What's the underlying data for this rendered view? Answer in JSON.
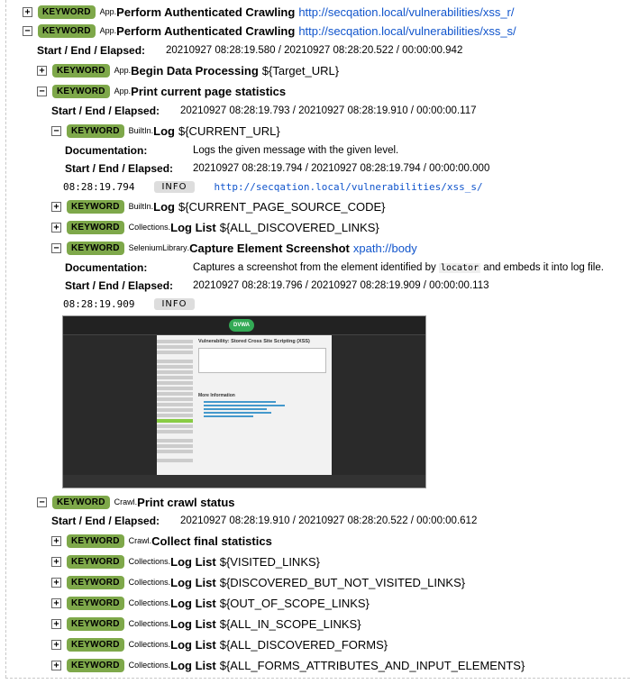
{
  "badge": "KEYWORD",
  "level_info": "INFO",
  "start_end_label": "Start / End / Elapsed:",
  "documentation_label": "Documentation:",
  "kw1": {
    "lib": "App",
    "name": "Perform Authenticated Crawling",
    "arg": "http://secqation.local/vulnerabilities/xss_r/",
    "toggle": "+"
  },
  "kw2": {
    "lib": "App",
    "name": "Perform Authenticated Crawling",
    "arg": "http://secqation.local/vulnerabilities/xss_s/",
    "toggle": "−",
    "times": "20210927 08:28:19.580 / 20210927 08:28:20.522 / 00:00:00.942"
  },
  "kw3": {
    "lib": "App",
    "name": "Begin Data Processing",
    "arg": "${Target_URL}",
    "toggle": "+"
  },
  "kw4": {
    "lib": "App",
    "name": "Print current page statistics",
    "toggle": "−",
    "times": "20210927 08:28:19.793 / 20210927 08:28:19.910 / 00:00:00.117"
  },
  "kw5": {
    "lib": "BuiltIn",
    "name": "Log",
    "arg": "${CURRENT_URL}",
    "toggle": "−",
    "doc": "Logs the given message with the given level.",
    "times": "20210927 08:28:19.794 / 20210927 08:28:19.794 / 00:00:00.000",
    "msg_time": "08:28:19.794",
    "msg": "http://secqation.local/vulnerabilities/xss_s/"
  },
  "kw6": {
    "lib": "BuiltIn",
    "name": "Log",
    "arg": "${CURRENT_PAGE_SOURCE_CODE}",
    "toggle": "+"
  },
  "kw7": {
    "lib": "Collections",
    "name": "Log List",
    "arg": "${ALL_DISCOVERED_LINKS}",
    "toggle": "+"
  },
  "kw8": {
    "lib": "SeleniumLibrary",
    "name": "Capture Element Screenshot",
    "arg": "xpath://body",
    "toggle": "−",
    "doc_pre": "Captures a screenshot from the element identified by ",
    "doc_code": "locator",
    "doc_post": " and embeds it into log file.",
    "times": "20210927 08:28:19.796 / 20210927 08:28:19.909 / 00:00:00.113",
    "msg_time": "08:28:19.909"
  },
  "screenshot": {
    "logo": "DVWA",
    "title": "Vulnerability: Stored Cross Site Scripting (XSS)",
    "more": "More Information"
  },
  "kw9": {
    "lib": "Crawl",
    "name": "Print crawl status",
    "toggle": "−",
    "times": "20210927 08:28:19.910 / 20210927 08:28:20.522 / 00:00:00.612"
  },
  "kw10": {
    "lib": "Crawl",
    "name": "Collect final statistics",
    "toggle": "+"
  },
  "kw11": {
    "lib": "Collections",
    "name": "Log List",
    "arg": "${VISITED_LINKS}",
    "toggle": "+"
  },
  "kw12": {
    "lib": "Collections",
    "name": "Log List",
    "arg": "${DISCOVERED_BUT_NOT_VISITED_LINKS}",
    "toggle": "+"
  },
  "kw13": {
    "lib": "Collections",
    "name": "Log List",
    "arg": "${OUT_OF_SCOPE_LINKS}",
    "toggle": "+"
  },
  "kw14": {
    "lib": "Collections",
    "name": "Log List",
    "arg": "${ALL_IN_SCOPE_LINKS}",
    "toggle": "+"
  },
  "kw15": {
    "lib": "Collections",
    "name": "Log List",
    "arg": "${ALL_DISCOVERED_FORMS}",
    "toggle": "+"
  },
  "kw16": {
    "lib": "Collections",
    "name": "Log List",
    "arg": "${ALL_FORMS_ATTRIBUTES_AND_INPUT_ELEMENTS}",
    "toggle": "+"
  }
}
